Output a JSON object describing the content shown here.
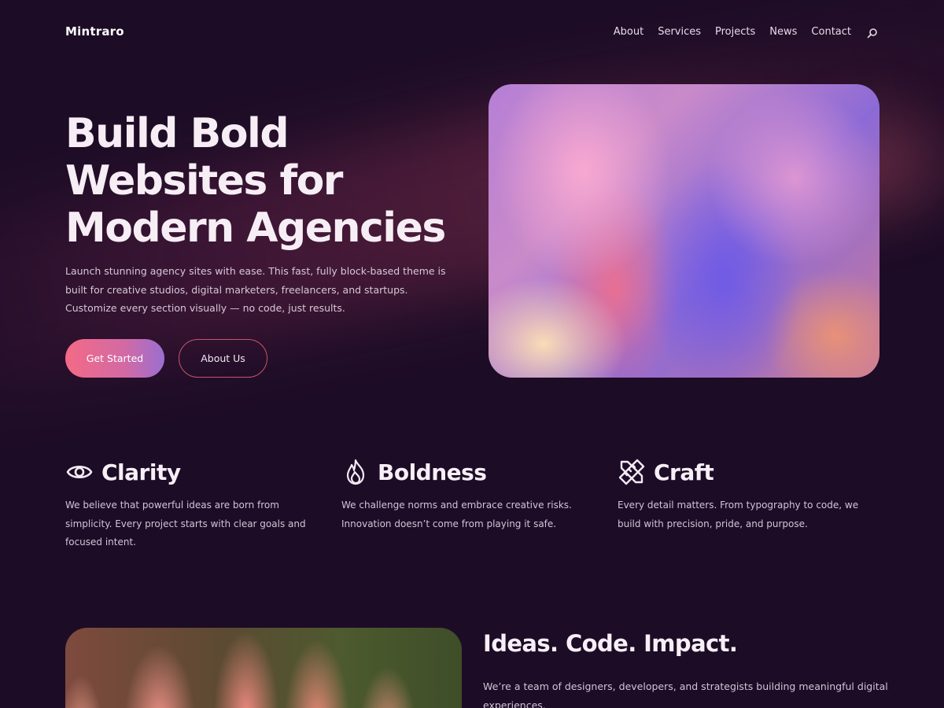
{
  "brand": {
    "name": "Mintraro"
  },
  "nav": {
    "items": [
      "About",
      "Services",
      "Projects",
      "News",
      "Contact"
    ],
    "search_icon": "search-icon"
  },
  "hero": {
    "title_lines": [
      "Build Bold",
      "Websites for",
      "Modern Agencies"
    ],
    "description": "Launch stunning agency sites with ease. This fast, fully block-based theme is built for creative studios, digital marketers, freelancers, and startups. Customize every section visually — no code, just results.",
    "primary_button": "Get Started",
    "secondary_button": "About Us"
  },
  "values": [
    {
      "icon": "eye-icon",
      "title": "Clarity",
      "text": "We believe that powerful ideas are born from simplicity. Every project starts with clear goals and focused intent."
    },
    {
      "icon": "flame-icon",
      "title": "Boldness",
      "text": "We challenge norms and embrace creative risks. Innovation doesn’t come from playing it safe."
    },
    {
      "icon": "pencil-ruler-icon",
      "title": "Craft",
      "text": "Every detail matters. From typography to code, we build with precision, pride, and purpose."
    }
  ],
  "ideas": {
    "title": "Ideas. Code. Impact.",
    "text": "We’re a team of designers, developers, and strategists building meaningful digital experiences."
  },
  "colors": {
    "background": "#1d0c26",
    "accent_gradient_start": "#f46a86",
    "accent_gradient_end": "#9a6fd0",
    "outline_button_border": "#c8546c"
  }
}
